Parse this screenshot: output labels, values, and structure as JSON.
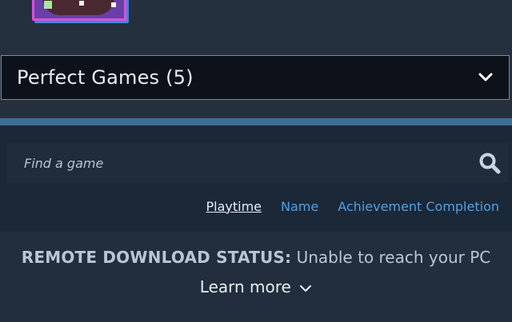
{
  "filter": {
    "selected": "Perfect Games (5)"
  },
  "search": {
    "placeholder": "Find a game"
  },
  "sort": {
    "options": [
      "Playtime",
      "Name",
      "Achievement Completion"
    ],
    "active": "Playtime"
  },
  "remote_download": {
    "label": "REMOTE DOWNLOAD STATUS:",
    "status": "Unable to reach your PC",
    "learn_more": "Learn more"
  },
  "icons": {
    "search": "search-icon",
    "dropdown": "chevron-down-icon",
    "expand": "chevron-down-icon"
  },
  "colors": {
    "background": "#1b2838",
    "accent_link": "#4ea1e8",
    "dropdown_border": "#6a8fb0",
    "stripe": "#3a6f96"
  }
}
